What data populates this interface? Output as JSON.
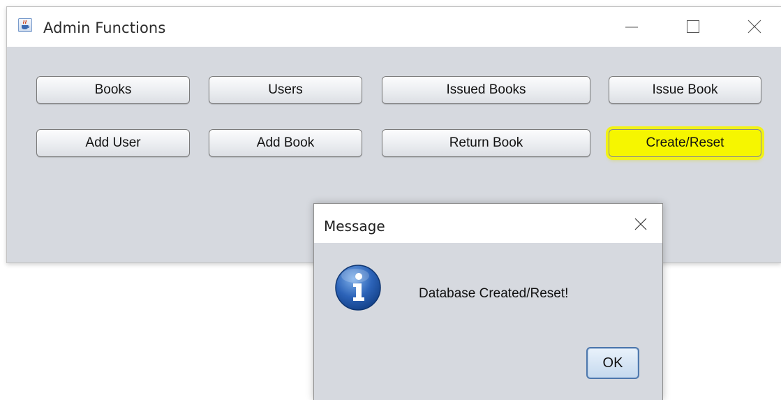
{
  "window": {
    "title": "Admin Functions",
    "icon": "java-cup-icon",
    "controls": [
      "minimize-icon",
      "maximize-icon",
      "close-icon"
    ]
  },
  "buttons": {
    "row1": [
      "Books",
      "Users",
      "Issued Books",
      "Issue Book"
    ],
    "row2": [
      "Add User",
      "Add Book",
      "Return Book",
      "Create/Reset"
    ],
    "highlighted": "Create/Reset",
    "highlight_color": "#f6f600"
  },
  "dialog": {
    "title": "Message",
    "icon": "information-icon",
    "message": "Database Created/Reset!",
    "ok_label": "OK"
  },
  "colors": {
    "window_bg": "#d6d9df",
    "titlebar_bg": "#ffffff",
    "ok_border": "#4f79ad"
  }
}
